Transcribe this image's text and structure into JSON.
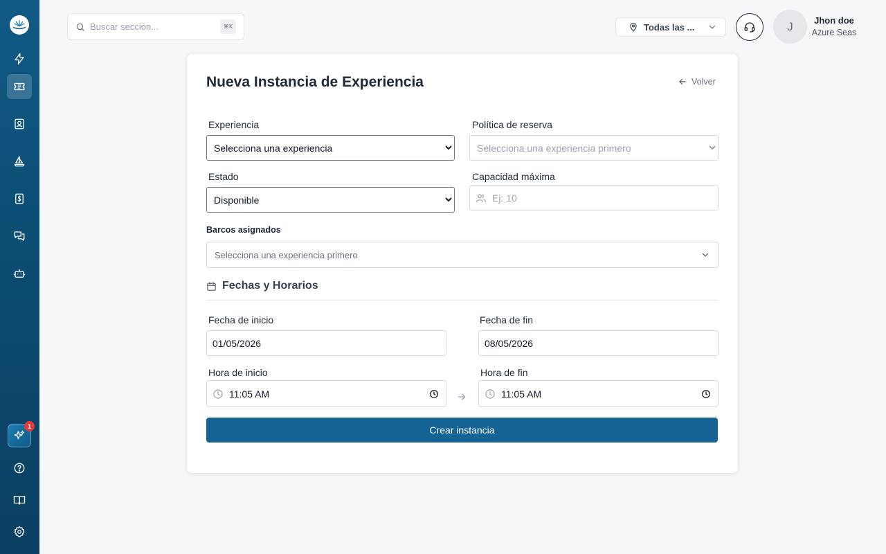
{
  "colors": {
    "sidebar": "#0c4d73",
    "primary": "#156394",
    "badge": "#e5383b"
  },
  "sidebar": {
    "items": [
      {
        "icon": "lightning-icon",
        "active": false
      },
      {
        "icon": "ticket-icon",
        "active": true
      },
      {
        "icon": "contact-card-icon",
        "active": false
      },
      {
        "icon": "sailboat-icon",
        "active": false
      },
      {
        "icon": "dollar-receipt-icon",
        "active": false
      },
      {
        "icon": "chat-icon",
        "active": false
      },
      {
        "icon": "robot-icon",
        "active": false
      }
    ],
    "assistant_badge": "1",
    "bottom": [
      {
        "icon": "help-icon"
      },
      {
        "icon": "book-icon"
      },
      {
        "icon": "gear-icon"
      }
    ]
  },
  "header": {
    "search_placeholder": "Buscar sección...",
    "search_shortcut": "⌘K",
    "location": "Todas las ...",
    "user": {
      "initial": "J",
      "name": "Jhon doe",
      "org": "Azure Seas"
    }
  },
  "form": {
    "title": "Nueva Instancia de Experiencia",
    "back_label": "Volver",
    "experiencia": {
      "label": "Experiencia",
      "value": "Selecciona una experiencia"
    },
    "politica": {
      "label": "Política de reserva",
      "value": "Selecciona una experiencia primero"
    },
    "estado": {
      "label": "Estado",
      "value": "Disponible"
    },
    "capacidad": {
      "label": "Capacidad máxima",
      "placeholder": "Ej: 10"
    },
    "barcos": {
      "label": "Barcos asignados",
      "placeholder": "Selecciona una experiencia primero"
    },
    "fechas_section": "Fechas y Horarios",
    "fecha_inicio": {
      "label": "Fecha de inicio",
      "value": "01/05/2026"
    },
    "fecha_fin": {
      "label": "Fecha de fin",
      "value": "08/05/2026"
    },
    "hora_inicio": {
      "label": "Hora de inicio",
      "value": "11:05 AM"
    },
    "hora_fin": {
      "label": "Hora de fin",
      "value": "11:05 AM"
    },
    "submit_label": "Crear instancia"
  }
}
